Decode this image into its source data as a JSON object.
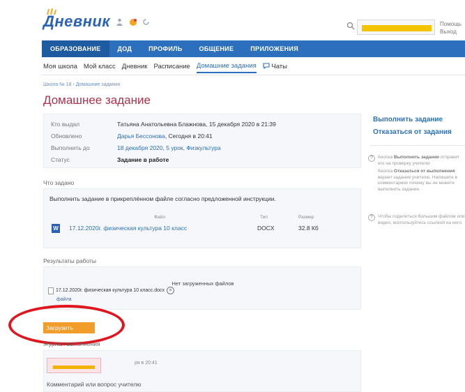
{
  "header": {
    "logo": "Дневник",
    "help_label": "Помощь",
    "logout_label": "Выход"
  },
  "main_nav": {
    "items": [
      "ОБРАЗОВАНИЕ",
      "ДОД",
      "ПРОФИЛЬ",
      "ОБЩЕНИЕ",
      "ПРИЛОЖЕНИЯ"
    ]
  },
  "sub_nav": {
    "items": [
      "Моя школа",
      "Мой класс",
      "Дневник",
      "Расписание",
      "Домашние задания",
      "Чаты"
    ],
    "active": "Домашние задания"
  },
  "breadcrumbs": {
    "school": "Школа № 18",
    "separator": "›",
    "current": "Домашние задания"
  },
  "page": {
    "title": "Домашнее задание"
  },
  "info": {
    "issued_by_label": "Кто выдал",
    "issued_by_value": "Татьяна Анатольевна Блажнова, 15 декабря 2020 в 21:39",
    "updated_label": "Обновлено",
    "updated_name": "Дарья Бессонова",
    "updated_time": ", Сегодня в 20:41",
    "due_label": "Выполнить до",
    "due_value": "18 декабря 2020, 5 урок, Физкультура",
    "status_label": "Статус",
    "status_value": "Задание в работе"
  },
  "task": {
    "section_label": "Что задано",
    "text": "Выполнить задание в прикреплённом файле согласно предложенной инструкции.",
    "col_file": "Файл",
    "col_type": "Тип",
    "col_size": "Размер",
    "file_icon": "W",
    "file_name": "17.12.2020г. физическая культура 10 класс",
    "file_type": "DOCX",
    "file_size": "32.8 Кб"
  },
  "results": {
    "section_label": "Результаты работы",
    "no_files": "Нет загруженных файлов",
    "uploaded_file": "17.12.2020г. физическая культура 10 класс.docx",
    "remove_icon": "×",
    "attach_link": "файла",
    "upload_button": "Загрузить"
  },
  "journal": {
    "section_label": "Журнал выполнения",
    "date": "ря в 20:41",
    "comment_label": "Комментарий или вопрос учителю"
  },
  "sidebar": {
    "complete_link": "Выполнить задание",
    "refuse_link": "Отказаться от задания",
    "hint1_prefix": "Кнопка ",
    "hint1_bold": "Выполнить задание",
    "hint1_rest": " отправит его на проверку учителю",
    "hint2_prefix": "Кнопка ",
    "hint2_bold": "Отказаться от выполнения",
    "hint2_rest": " вернет задание учителю. Напишите в комментариях почему вы не можете выполнить задание.",
    "hint3": "Чтобы поделиться большим файлом или видео, воспользуйтесь ссылкой на него.",
    "hint_icon": "?"
  },
  "colors": {
    "brand_blue": "#2c70bd",
    "title_red": "#b0324a",
    "upload_orange": "#f29d2b",
    "annotation_red": "#e0161e",
    "redaction_yellow": "#f5c400"
  }
}
